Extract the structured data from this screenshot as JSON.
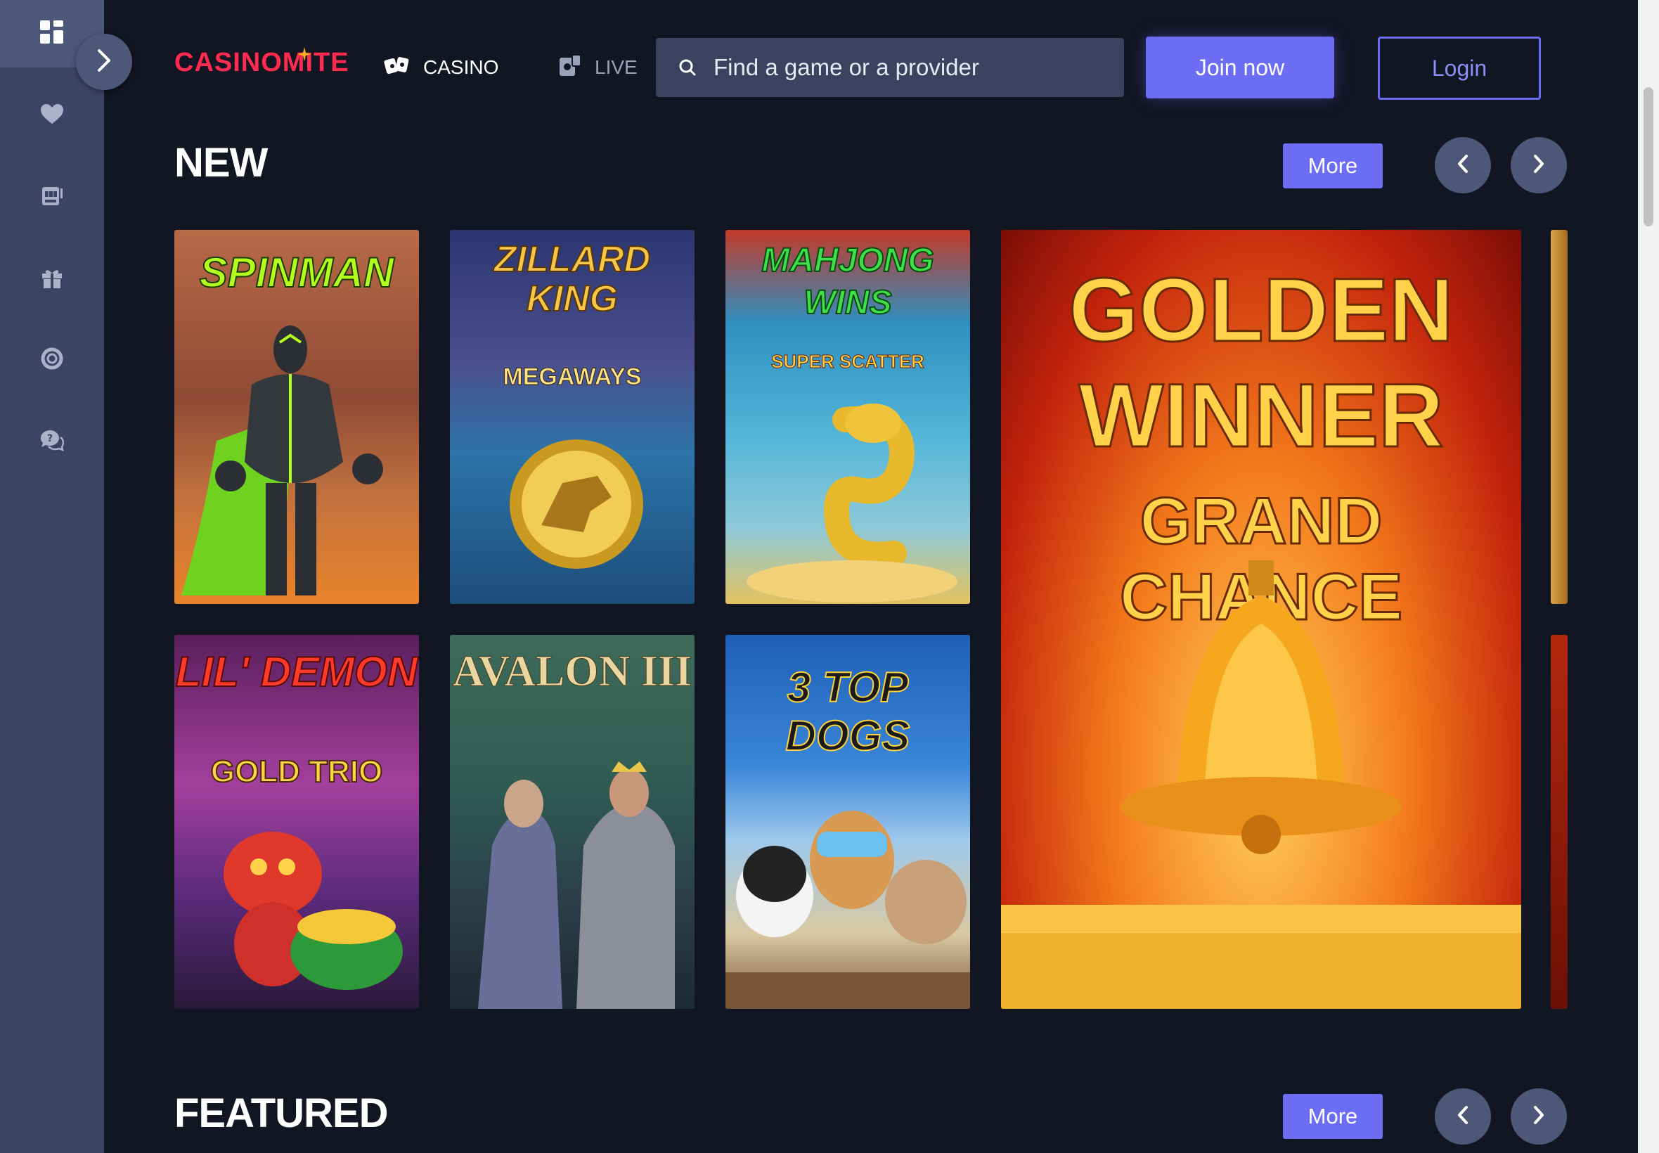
{
  "sidebar": {
    "items": [
      {
        "icon": "dashboard-icon"
      },
      {
        "icon": "heart-icon"
      },
      {
        "icon": "slot-machine-icon"
      },
      {
        "icon": "gift-icon"
      },
      {
        "icon": "lifebuoy-icon"
      },
      {
        "icon": "chat-support-icon"
      }
    ],
    "expand_icon": "chevron-right-icon"
  },
  "header": {
    "logo": "CASINOMITE",
    "nav": [
      {
        "label": "CASINO",
        "icon": "cards-icon",
        "active": true
      },
      {
        "label": "LIVE",
        "icon": "live-dealer-icon",
        "active": false
      }
    ],
    "search_placeholder": "Find a game or a provider",
    "join_label": "Join now",
    "login_label": "Login"
  },
  "sections": {
    "new": {
      "title": "NEW",
      "more_label": "More",
      "games": [
        {
          "title": "SPINMAN"
        },
        {
          "title": "ZILLARD KING",
          "subtitle": "MEGAWAYS"
        },
        {
          "title": "MAHJONG WINS",
          "subtitle": "SUPER SCATTER"
        },
        {
          "title": "GOLDEN WINNER",
          "subtitle": "GRAND CHANCE"
        },
        {
          "title": "LIL' DEMON",
          "subtitle": "GOLD TRIO"
        },
        {
          "title": "AVALON III"
        },
        {
          "title": "3 TOP DOGS"
        }
      ]
    },
    "featured": {
      "title": "FEATURED",
      "more_label": "More"
    }
  },
  "colors": {
    "background": "#121522",
    "sidebar": "#3c4463",
    "accent": "#6b6ef5",
    "logo": "#ff2a4f"
  }
}
